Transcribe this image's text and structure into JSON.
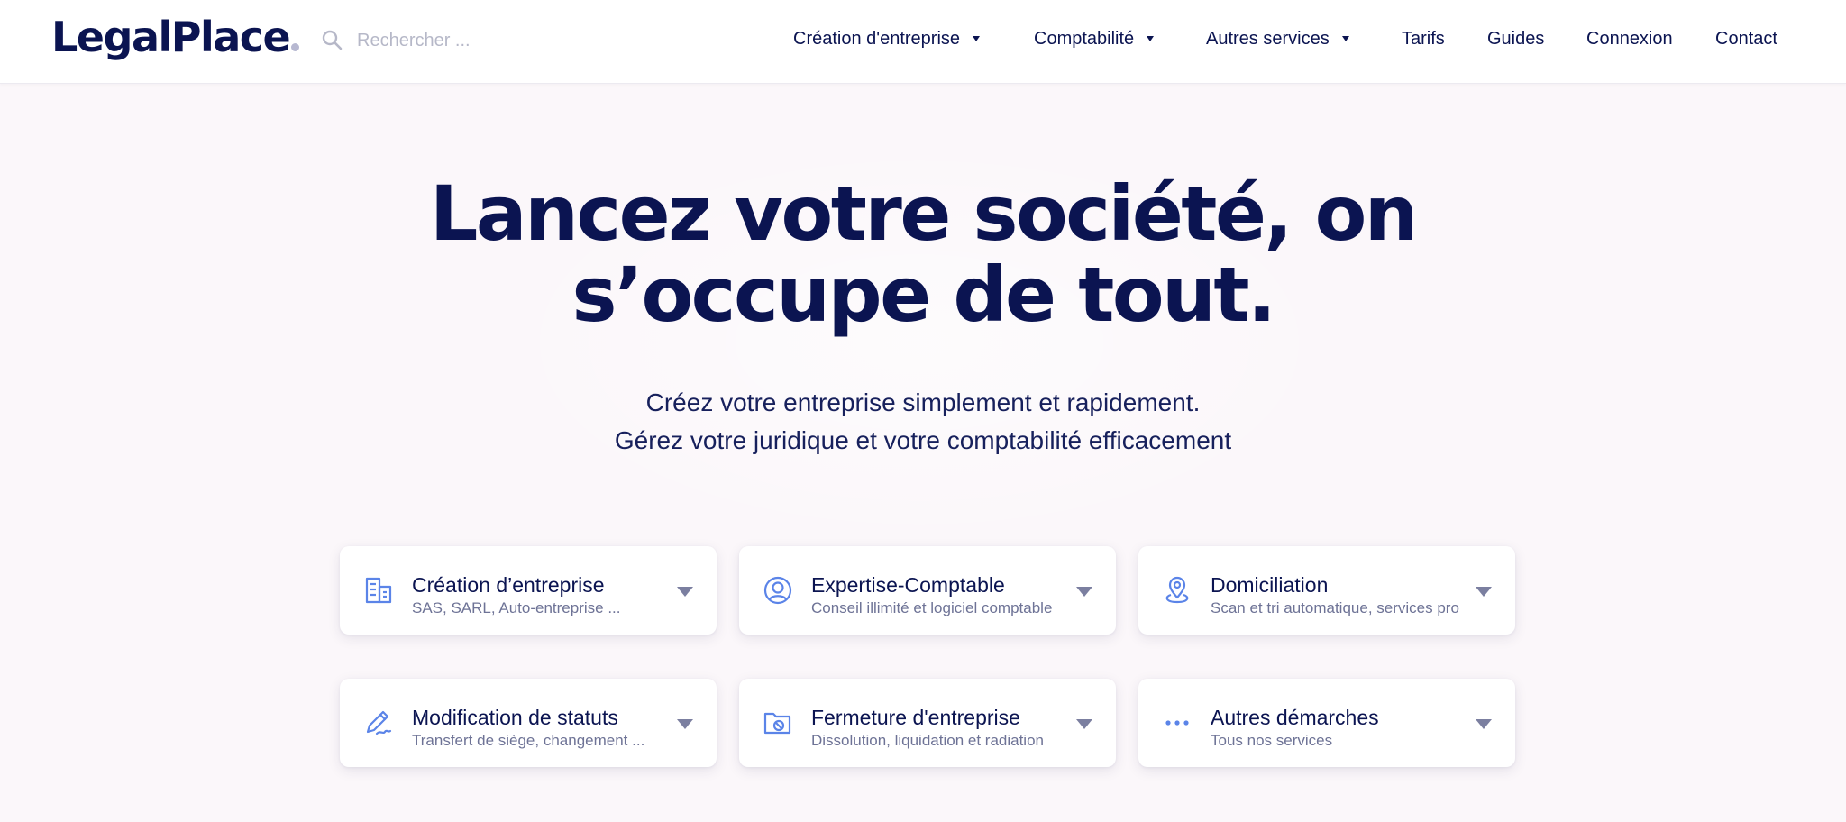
{
  "colors": {
    "navy": "#0b1451",
    "accent_blue": "#5b84e8",
    "background": "#fbf7fa",
    "muted": "#6e7396"
  },
  "header": {
    "logo": "LegalPlace",
    "search_placeholder": "Rechercher ...",
    "search_icon": "search-icon",
    "nav": [
      {
        "label": "Création d'entreprise",
        "has_dropdown": true
      },
      {
        "label": "Comptabilité",
        "has_dropdown": true
      },
      {
        "label": "Autres services",
        "has_dropdown": true
      },
      {
        "label": "Tarifs",
        "has_dropdown": false
      },
      {
        "label": "Guides",
        "has_dropdown": false
      },
      {
        "label": "Connexion",
        "has_dropdown": false
      },
      {
        "label": "Contact",
        "has_dropdown": false
      }
    ]
  },
  "hero": {
    "title_line1": "Lancez votre société, on",
    "title_line2": "s’occupe de tout.",
    "subtitle_line1": "Créez votre entreprise simplement et rapidement.",
    "subtitle_line2": "Gérez votre juridique et votre comptabilité efficacement"
  },
  "services": [
    {
      "title": "Création d’entreprise",
      "desc": "SAS, SARL, Auto-entreprise ...",
      "icon": "building-icon"
    },
    {
      "title": "Expertise-Comptable",
      "desc": "Conseil illimité et logiciel comptable",
      "icon": "user-circle-icon"
    },
    {
      "title": "Domiciliation",
      "desc": "Scan et tri automatique, services pro",
      "icon": "map-pin-icon"
    },
    {
      "title": "Modification de statuts",
      "desc": "Transfert de siège, changement ...",
      "icon": "pen-icon"
    },
    {
      "title": "Fermeture d'entreprise",
      "desc": "Dissolution, liquidation et radiation",
      "icon": "folder-close-icon"
    },
    {
      "title": "Autres démarches",
      "desc": "Tous nos services",
      "icon": "more-dots-icon"
    }
  ]
}
